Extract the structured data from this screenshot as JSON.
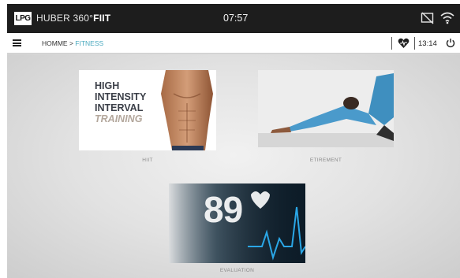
{
  "statusbar": {
    "logo": "LPG",
    "brand_name": "HUBER 360°",
    "brand_suffix": "FIIT",
    "time": "07:57",
    "icons": [
      "cast-off-icon",
      "wifi-icon"
    ]
  },
  "navbar": {
    "menu_icon": "hamburger-menu-icon",
    "breadcrumb_home": "HOMME >",
    "breadcrumb_current": "FITNESS",
    "heart_icon": "heart-rate-icon",
    "session_time": "13:14",
    "power_icon": "power-icon"
  },
  "tiles": [
    {
      "label": "HIIT",
      "image_text": [
        "HIGH",
        "INTENSITY",
        "INTERVAL",
        "TRAINING"
      ]
    },
    {
      "label": "ETIREMENT"
    },
    {
      "label": "EVALUATION",
      "image_text": "89"
    }
  ],
  "colors": {
    "statusbar_bg": "#1d1d1d",
    "accent": "#4aa9bf",
    "content_bg": "#e2e2e2"
  }
}
